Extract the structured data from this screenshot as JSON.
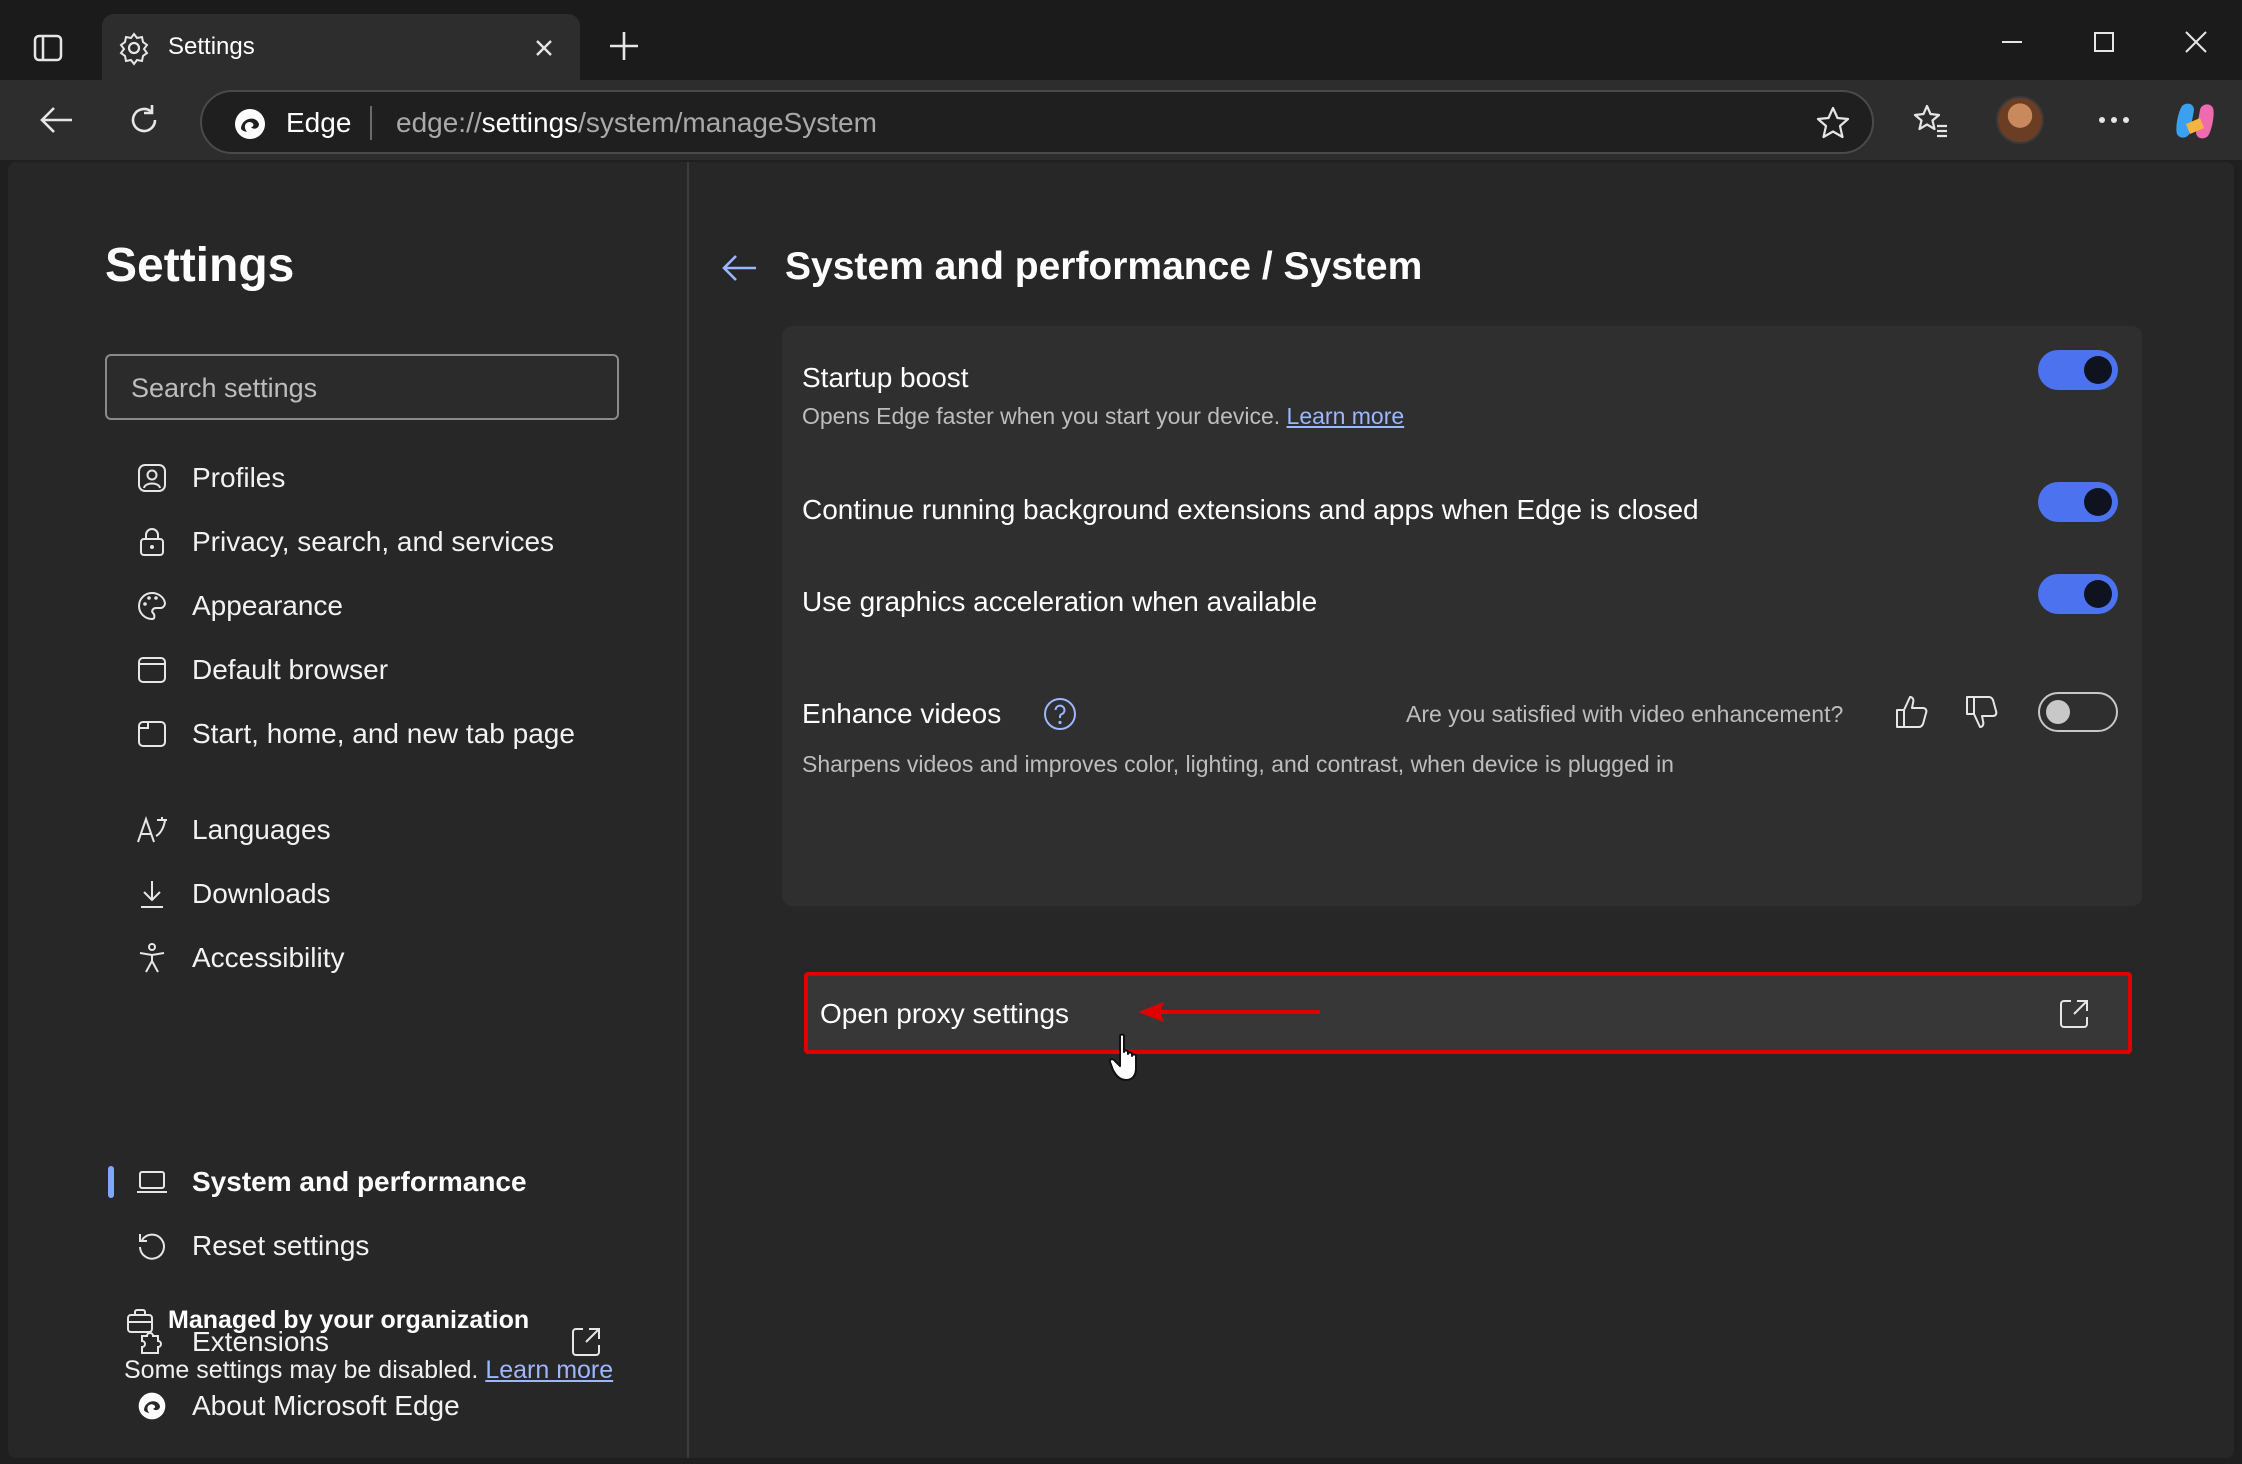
{
  "tab": {
    "title": "Settings",
    "icon": "gear-icon"
  },
  "address": {
    "brand": "Edge",
    "url_prefix": "edge://",
    "url_host": "settings",
    "url_path": "/system/manageSystem"
  },
  "sidebar": {
    "title": "Settings",
    "search_placeholder": "Search settings",
    "items": [
      {
        "label": "Profiles",
        "icon": "profile-icon"
      },
      {
        "label": "Privacy, search, and services",
        "icon": "lock-icon"
      },
      {
        "label": "Appearance",
        "icon": "palette-icon"
      },
      {
        "label": "Default browser",
        "icon": "browser-icon"
      },
      {
        "label": "Start, home, and new tab page",
        "icon": "home-tab-icon"
      },
      {
        "label": "Languages",
        "icon": "language-icon"
      },
      {
        "label": "Downloads",
        "icon": "download-icon"
      },
      {
        "label": "Accessibility",
        "icon": "accessibility-icon"
      },
      {
        "label": "System and performance",
        "icon": "laptop-icon",
        "active": true
      },
      {
        "label": "Reset settings",
        "icon": "reset-icon"
      },
      {
        "label": "Extensions",
        "icon": "puzzle-icon"
      },
      {
        "label": "About Microsoft Edge",
        "icon": "edge-logo-icon"
      }
    ],
    "managed_title": "Managed by your organization",
    "managed_desc": "Some settings may be disabled.",
    "managed_link": "Learn more"
  },
  "main": {
    "breadcrumb": "System and performance / System",
    "startup_boost": {
      "title": "Startup boost",
      "desc": "Opens Edge faster when you start your device.",
      "link": "Learn more",
      "enabled": true
    },
    "background": {
      "title": "Continue running background extensions and apps when Edge is closed",
      "enabled": true
    },
    "graphics": {
      "title": "Use graphics acceleration when available",
      "enabled": true
    },
    "enhance": {
      "title": "Enhance videos",
      "question": "Are you satisfied with video enhancement?",
      "desc": "Sharpens videos and improves color, lighting, and contrast, when device is plugged in",
      "enabled": false
    },
    "proxy": {
      "title": "Open proxy settings"
    }
  },
  "colors": {
    "accent": "#4c72f0",
    "highlight": "#e00000",
    "link": "#9cb6ff"
  }
}
